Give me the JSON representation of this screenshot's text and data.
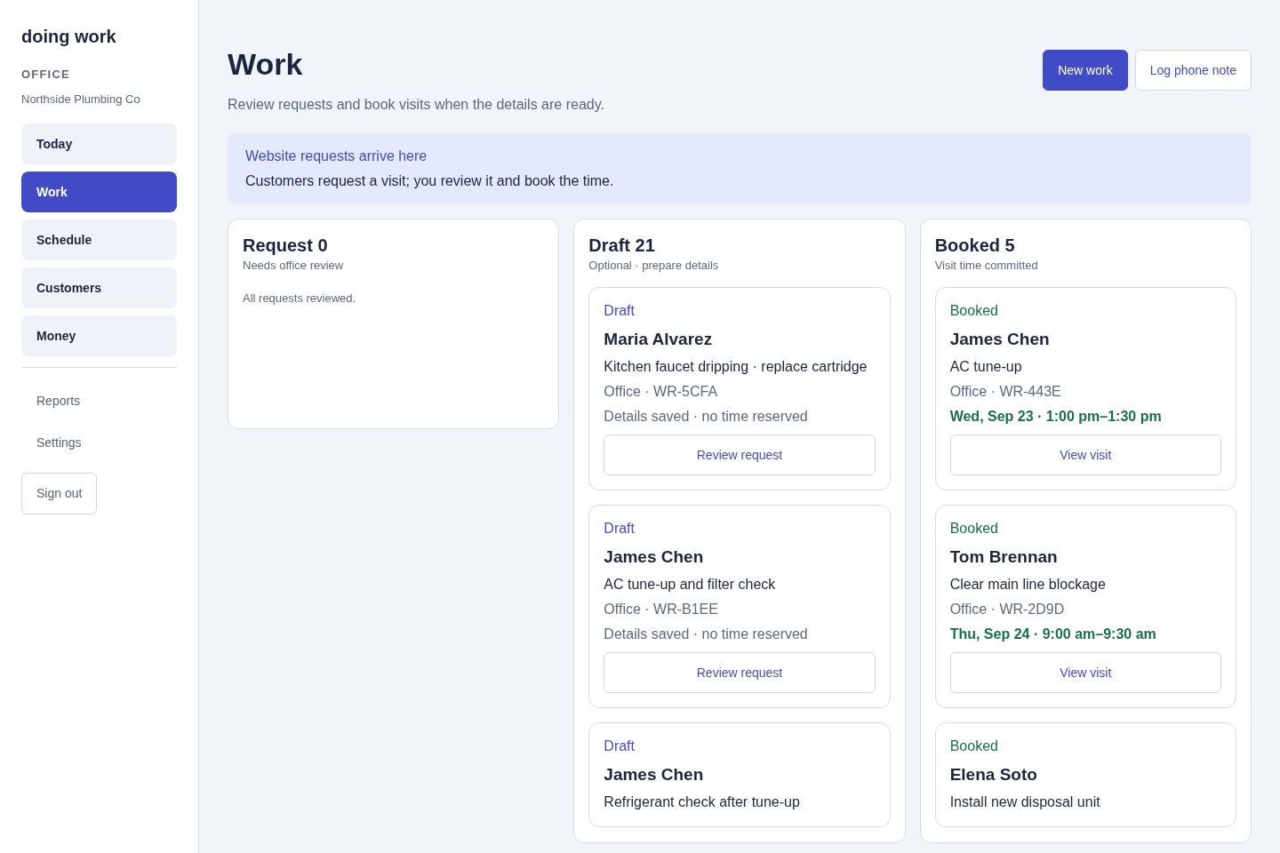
{
  "sidebar": {
    "brand": "doing work",
    "section_label": "OFFICE",
    "office_name": "Northside Plumbing Co",
    "nav_items": [
      {
        "label": "Today",
        "selected": false
      },
      {
        "label": "Work",
        "selected": true
      },
      {
        "label": "Schedule",
        "selected": false
      },
      {
        "label": "Customers",
        "selected": false
      },
      {
        "label": "Money",
        "selected": false
      }
    ],
    "secondary_items": [
      "Reports",
      "Settings"
    ],
    "sign_out": "Sign out"
  },
  "header": {
    "title": "Work",
    "subtitle": "Review requests and book visits when the details are ready.",
    "buttons": [
      {
        "label": "New work",
        "kind": "primary"
      },
      {
        "label": "Log phone note",
        "kind": "outline"
      }
    ]
  },
  "notice": {
    "title": "Website requests arrive here",
    "text": "Customers request a visit; you review it and book the time."
  },
  "columns": [
    {
      "title": "Request 0",
      "subtitle": "Needs office review",
      "empty_text": "All requests reviewed."
    },
    {
      "title": "Draft 21",
      "subtitle": "Optional · prepare details",
      "items": [
        {
          "kind": "draft",
          "status": "Draft",
          "name": "Maria Alvarez",
          "description": "Kitchen faucet dripping · replace cartridge",
          "reference": "Office · WR-5CFA",
          "detail": "Details saved · no time reserved",
          "action": "Review request"
        },
        {
          "kind": "draft",
          "status": "Draft",
          "name": "James Chen",
          "description": "AC tune-up and filter check",
          "reference": "Office · WR-B1EE",
          "detail": "Details saved · no time reserved",
          "action": "Review request"
        },
        {
          "kind": "draft",
          "status": "Draft",
          "name": "James Chen",
          "description": "Refrigerant check after tune-up"
        }
      ]
    },
    {
      "title": "Booked 5",
      "subtitle": "Visit time committed",
      "items": [
        {
          "kind": "booked",
          "status": "Booked",
          "name": "James Chen",
          "description": "AC tune-up",
          "reference": "Office · WR-443E",
          "detail": "Wed, Sep 23 · 1:00 pm–1:30 pm",
          "action": "View visit"
        },
        {
          "kind": "booked",
          "status": "Booked",
          "name": "Tom Brennan",
          "description": "Clear main line blockage",
          "reference": "Office · WR-2D9D",
          "detail": "Thu, Sep 24 · 9:00 am–9:30 am",
          "action": "View visit"
        },
        {
          "kind": "booked",
          "status": "Booked",
          "name": "Elena Soto",
          "description": "Install new disposal unit"
        }
      ]
    }
  ]
}
